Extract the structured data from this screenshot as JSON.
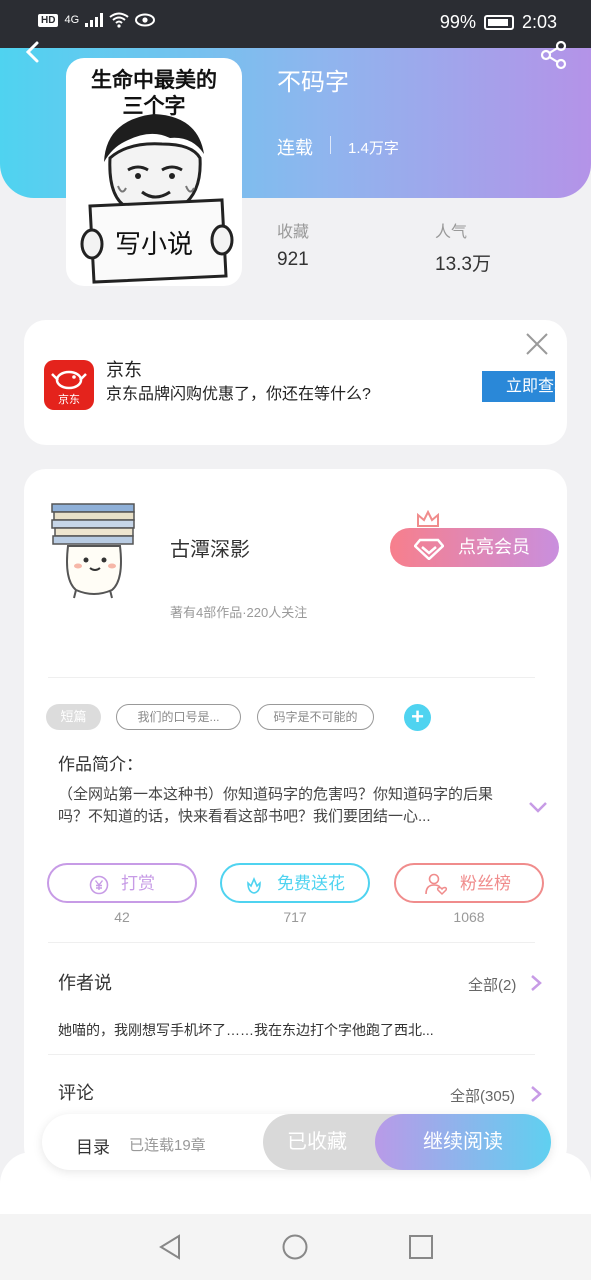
{
  "status_bar": {
    "left_badge": "HD",
    "network": "4G",
    "battery": "99%",
    "time": "2:03"
  },
  "book": {
    "title": "不码字",
    "cover_line1": "生命中最美的",
    "cover_line2": "三个字",
    "cover_sign": "写小说",
    "status": "连载",
    "word_count": "1.4万字",
    "stats": [
      {
        "label": "收藏",
        "value": "921"
      },
      {
        "label": "人气",
        "value": "13.3万"
      }
    ]
  },
  "ad": {
    "name": "京东",
    "logo_text": "京东",
    "description": "京东品牌闪购优惠了，你还在等什么?",
    "button": "立即查看"
  },
  "author": {
    "name": "古潭深影",
    "meta": "著有4部作品·220人关注",
    "vip_button": "点亮会员"
  },
  "tags": {
    "genre": "短篇",
    "items": [
      "我们的口号是...",
      "码字是不可能的"
    ],
    "add": "+"
  },
  "intro": {
    "label": "作品简介：",
    "text": "（全网站第一本这种书）你知道码字的危害吗？你知道码字的后果吗？不知道的话，快来看看这部书吧？我们要团结一心..."
  },
  "actions": [
    {
      "label": "打赏",
      "count": "42",
      "color": "#c79be6",
      "icon": "yen-icon"
    },
    {
      "label": "免费送花",
      "count": "717",
      "color": "#4fd3f0",
      "icon": "flower-icon"
    },
    {
      "label": "粉丝榜",
      "count": "1068",
      "color": "#f08c8c",
      "icon": "fans-icon"
    }
  ],
  "author_say": {
    "title": "作者说",
    "all": "全部(2)",
    "text": "她喵的，我刚想写手机坏了……我在东边打个字他跑了西北..."
  },
  "comments": {
    "title": "评论",
    "all": "全部(305)"
  },
  "bottom_bar": {
    "toc": "目录",
    "chapters": "已连载19章",
    "collected": "已收藏",
    "continue": "继续阅读"
  },
  "colors": {
    "accent_cyan": "#4fd3f0",
    "accent_purple": "#b493e8",
    "jd_red": "#e4231c",
    "ad_blue": "#2a88d8"
  }
}
